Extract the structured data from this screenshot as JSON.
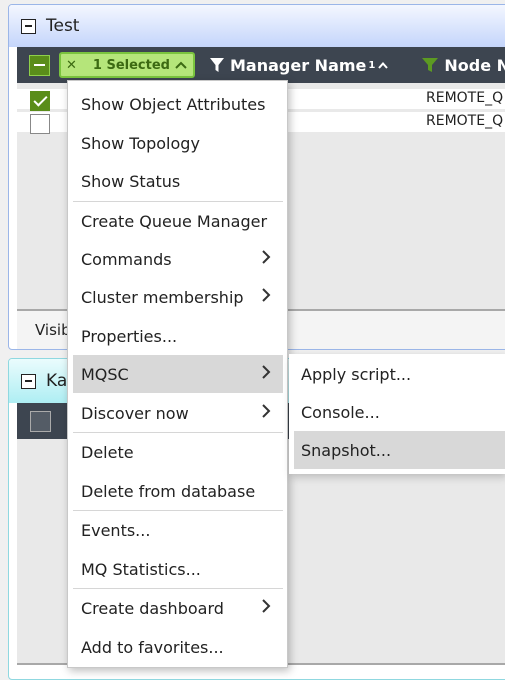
{
  "panel1": {
    "title": "Test",
    "selection_label": "1 Selected",
    "columns": [
      {
        "label": "Manager Name",
        "sort_index": "1"
      },
      {
        "label": "Node N"
      }
    ],
    "rows": [
      {
        "checked": true,
        "node": "REMOTE_Q"
      },
      {
        "checked": false,
        "node": "REMOTE_Q"
      }
    ],
    "footer_text": "Visib"
  },
  "panel2": {
    "title": "Ka"
  },
  "context_menu": {
    "items": [
      {
        "label": "Show Object Attributes"
      },
      {
        "label": "Show Topology"
      },
      {
        "label": "Show Status"
      },
      {
        "label": "Create Queue Manager"
      },
      {
        "label": "Commands"
      },
      {
        "label": "Cluster membership"
      },
      {
        "label": "Properties..."
      },
      {
        "label": "MQSC"
      },
      {
        "label": "Discover now"
      },
      {
        "label": "Delete"
      },
      {
        "label": "Delete from database"
      },
      {
        "label": "Events..."
      },
      {
        "label": "MQ Statistics..."
      },
      {
        "label": "Create dashboard"
      },
      {
        "label": "Add to favorites..."
      }
    ]
  },
  "submenu": {
    "items": [
      {
        "label": "Apply script..."
      },
      {
        "label": "Console..."
      },
      {
        "label": "Snapshot..."
      }
    ]
  },
  "colors": {
    "header_bg": "#3d4550",
    "accent_green": "#5a8d1a",
    "selection_pill": "#b5e57a",
    "highlight": "#d8d8d8"
  }
}
